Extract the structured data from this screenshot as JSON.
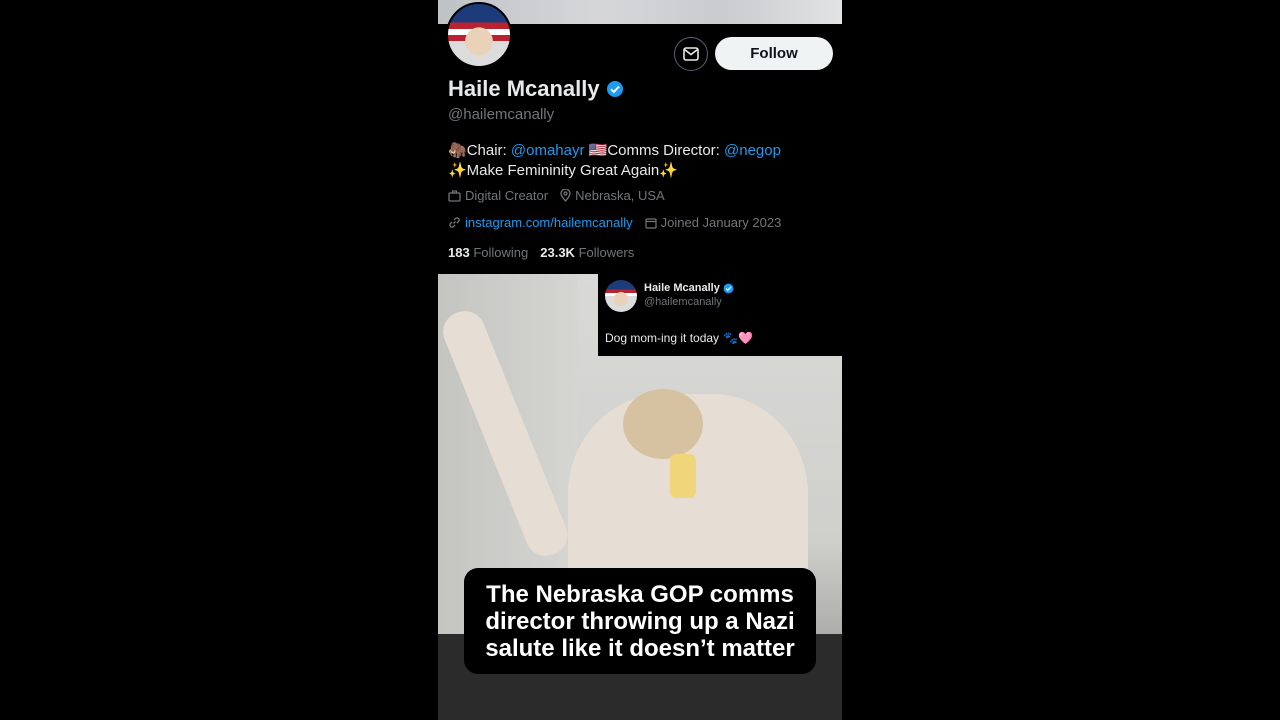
{
  "profile": {
    "display_name": "Haile Mcanally",
    "handle": "@hailemcanally",
    "follow_label": "Follow",
    "bio": {
      "line1_emoji": "🦣",
      "line1_prefix": "Chair: ",
      "line1_mention1": "@omahayr",
      "line1_flag": "🇺🇸",
      "line1_middle": "Comms Director: ",
      "line1_mention2": "@negop",
      "line2": "✨Make Femininity Great Again✨"
    },
    "category": "Digital Creator",
    "location": "Nebraska, USA",
    "website": "instagram.com/hailemcanally",
    "joined": "Joined January 2023",
    "following_count": "183",
    "following_label": "Following",
    "followers_count": "23.3K",
    "followers_label": "Followers"
  },
  "tweet": {
    "name": "Haile Mcanally",
    "handle": "@hailemcanally",
    "text": "Dog mom-ing it today",
    "emoji": "🐾🩷"
  },
  "caption": "The Nebraska GOP comms director throwing up a Nazi salute like it doesn’t matter",
  "colors": {
    "background": "#000000",
    "link": "#1d9bf0",
    "verified": "#1d9bf0",
    "muted": "#71767b"
  }
}
